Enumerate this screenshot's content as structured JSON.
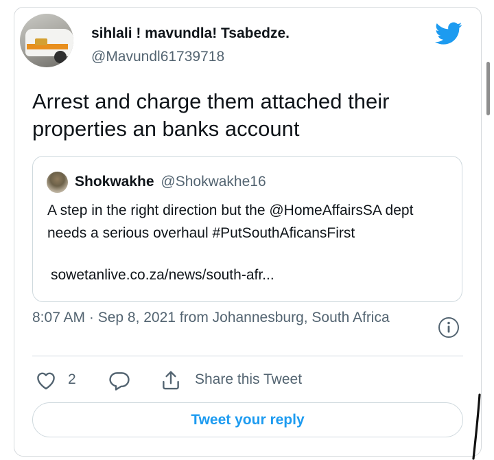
{
  "tweet": {
    "author": {
      "display_name": "sihlali ! mavundla! Tsabedze.",
      "handle": "@Mavundl61739718"
    },
    "text": "Arrest and charge them attached their properties an banks account",
    "quoted": {
      "display_name": "Shokwakhe",
      "handle": "@Shokwakhe16",
      "text": "A step in the right direction but the @HomeAffairsSA dept needs a serious overhaul #PutSouthAficansFirst",
      "link": "sowetanlive.co.za/news/south-afr..."
    },
    "meta": "8:07 AM · Sep 8, 2021 from Johannesburg, South Africa",
    "actions": {
      "like_count": "2",
      "share_label": "Share this Tweet"
    },
    "reply_button_label": "Tweet your reply"
  },
  "colors": {
    "accent": "#1d9bf0",
    "secondary_text": "#536471",
    "border": "#cfd9de"
  },
  "icons": [
    "twitter-bird-icon",
    "info-icon",
    "heart-icon",
    "reply-icon",
    "share-icon"
  ]
}
